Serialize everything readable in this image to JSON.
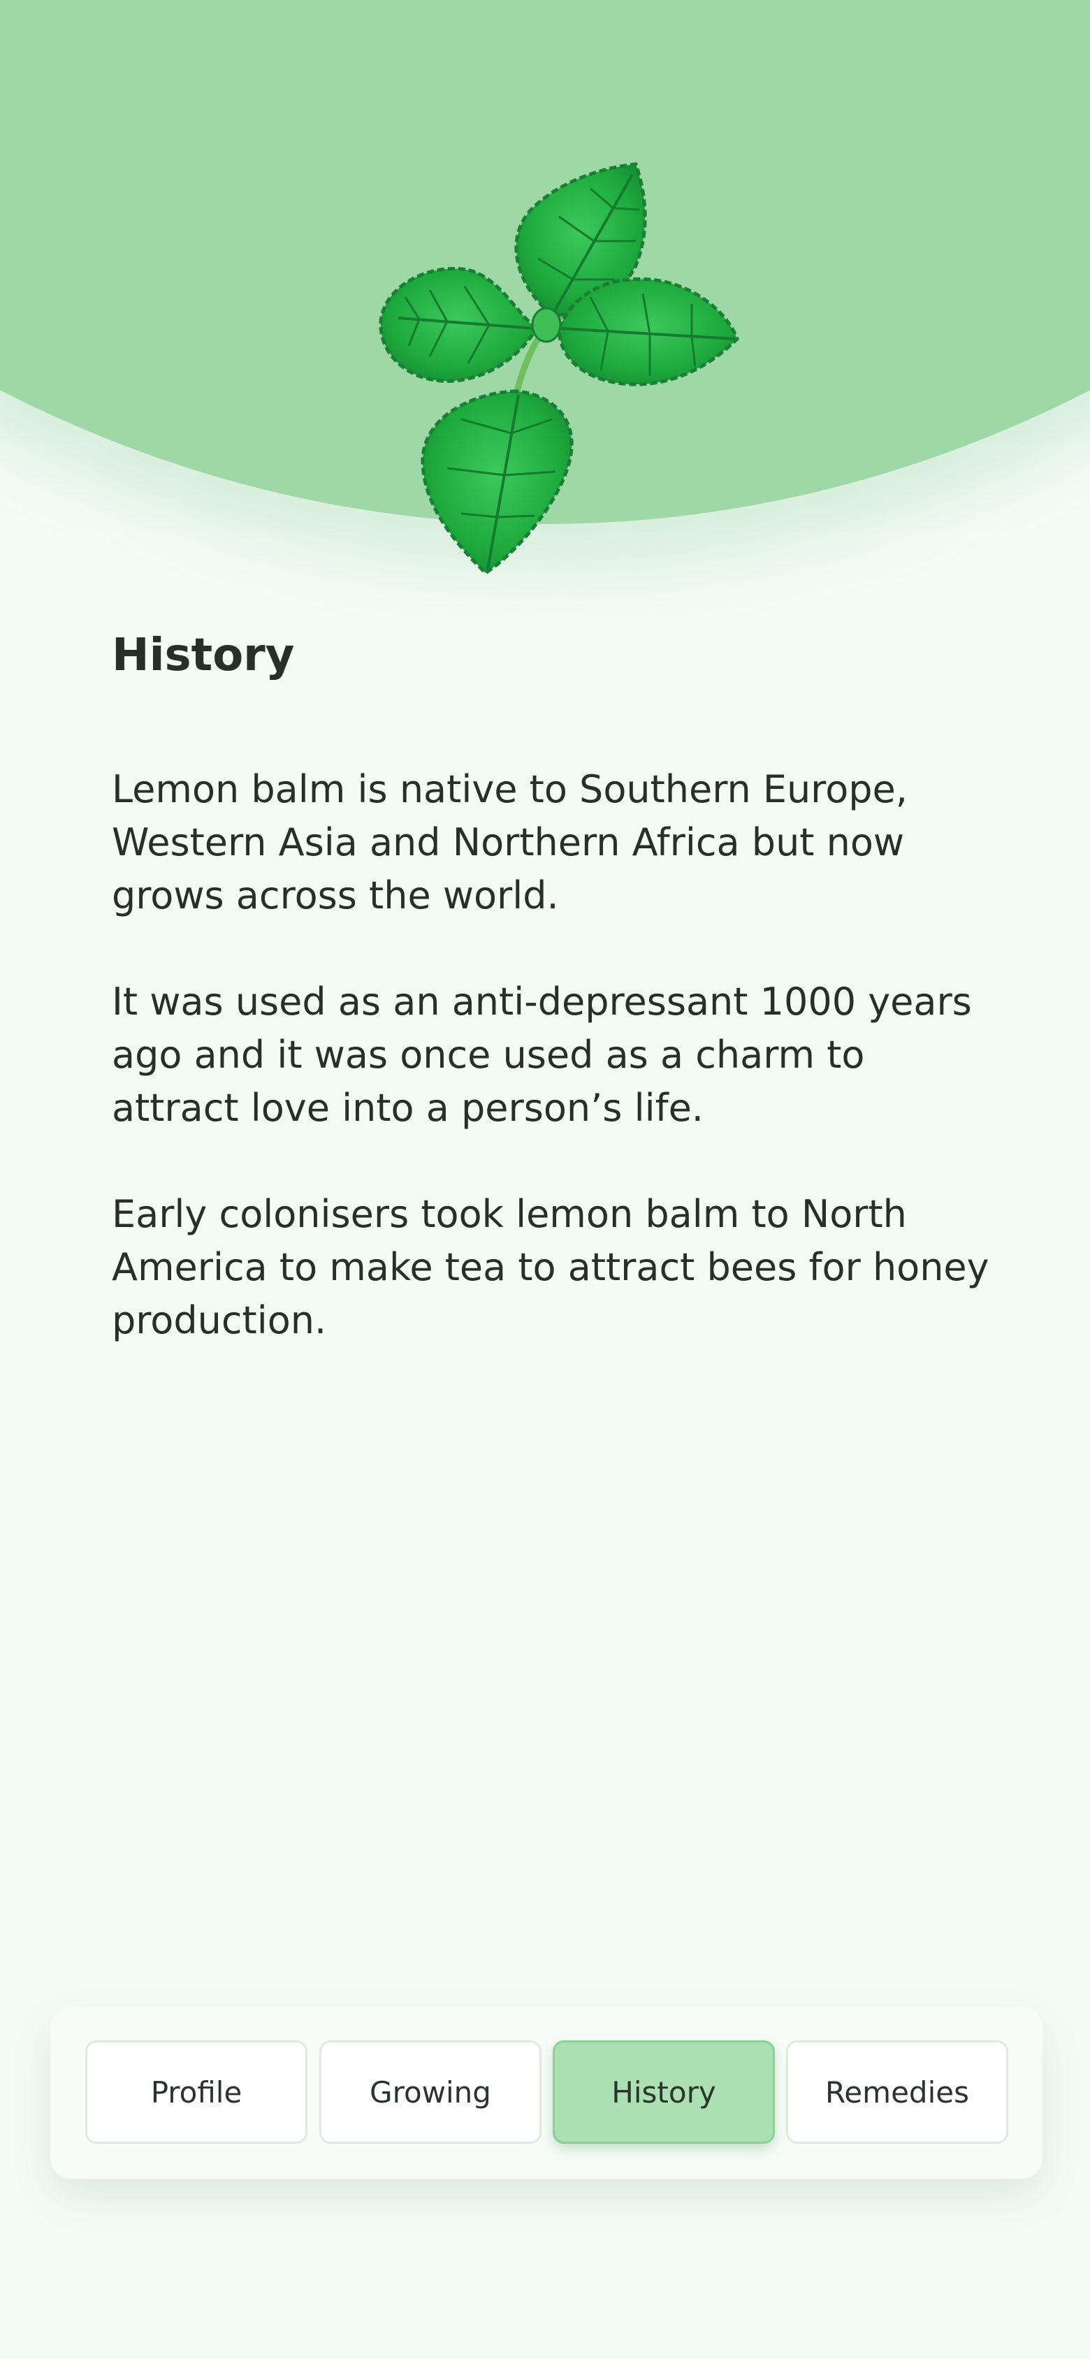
{
  "section": {
    "title": "History",
    "paragraphs": [
      "Lemon balm is native to Southern Europe, Western Asia and Northern Africa but now grows across the world.",
      "It was used as an anti-depressant 1000 years ago and it was once used as a charm to attract love into a person’s life.",
      "Early colonisers took lemon balm to North America to make tea to attract bees for honey production."
    ]
  },
  "tabs": [
    {
      "label": "Profile",
      "active": false
    },
    {
      "label": "Growing",
      "active": false
    },
    {
      "label": "History",
      "active": true
    },
    {
      "label": "Remedies",
      "active": false
    }
  ],
  "colors": {
    "header_green": "#9ed8a6",
    "background": "#f3fbf5",
    "active_tab": "#ace0b2",
    "text": "#243028"
  },
  "icons": {
    "hero": "lemon-balm-leaves-illustration"
  }
}
